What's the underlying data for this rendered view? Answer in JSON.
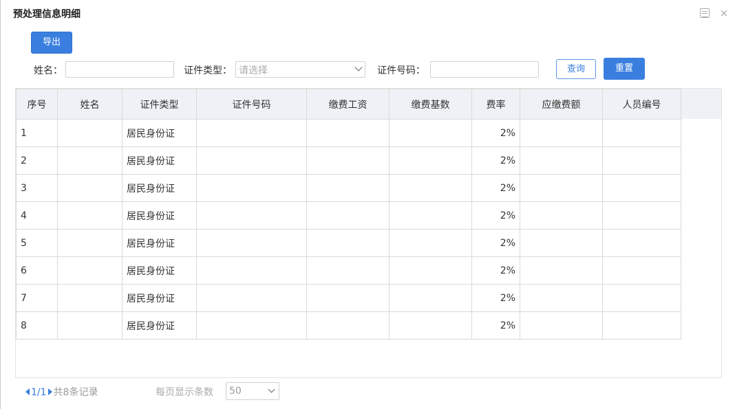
{
  "dialog": {
    "title": "预处理信息明细",
    "icons": {
      "maximize": "maximize-icon",
      "close": "close-icon"
    },
    "close_glyph": "×"
  },
  "toolbar": {
    "export_label": "导出"
  },
  "filters": {
    "name_label": "姓名：",
    "name_value": "",
    "id_type_label": "证件类型：",
    "id_type_placeholder": "请选择",
    "id_number_label": "证件号码：",
    "id_number_value": "",
    "query_label": "查询",
    "reset_label": "重置"
  },
  "table": {
    "columns": [
      "序号",
      "姓名",
      "证件类型",
      "证件号码",
      "缴费工资",
      "缴费基数",
      "费率",
      "应缴费额",
      "人员编号"
    ],
    "rows": [
      [
        "1",
        "",
        "居民身份证",
        "",
        "",
        "",
        "2%",
        "",
        ""
      ],
      [
        "2",
        "",
        "居民身份证",
        "",
        "",
        "",
        "2%",
        "",
        ""
      ],
      [
        "3",
        "",
        "居民身份证",
        "",
        "",
        "",
        "2%",
        "",
        ""
      ],
      [
        "4",
        "",
        "居民身份证",
        "",
        "",
        "",
        "2%",
        "",
        ""
      ],
      [
        "5",
        "",
        "居民身份证",
        "",
        "",
        "",
        "2%",
        "",
        ""
      ],
      [
        "6",
        "",
        "居民身份证",
        "",
        "",
        "",
        "2%",
        "",
        ""
      ],
      [
        "7",
        "",
        "居民身份证",
        "",
        "",
        "",
        "2%",
        "",
        ""
      ],
      [
        "8",
        "",
        "居民身份证",
        "",
        "",
        "",
        "2%",
        "",
        ""
      ]
    ]
  },
  "pagination": {
    "page": "1/1",
    "summary": "共8条记录",
    "page_size_label": "每页显示条数",
    "page_size": "50"
  },
  "colors": {
    "accent": "#3a7fe0",
    "header_bg": "#eef1f5",
    "border": "#d9d9d9"
  }
}
